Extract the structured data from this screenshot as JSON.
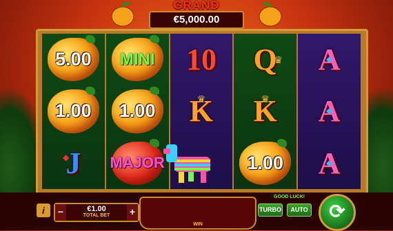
{
  "jackpot": {
    "label": "GRAND",
    "amount": "€5,000.00"
  },
  "reels": [
    {
      "cells": [
        {
          "type": "pepper",
          "text": "5.00"
        },
        {
          "type": "pepper",
          "text": "1.00"
        },
        {
          "type": "card",
          "text": "J",
          "variant": "j"
        }
      ]
    },
    {
      "cells": [
        {
          "type": "pepper",
          "text": "MINI",
          "variant": "mini"
        },
        {
          "type": "pepper",
          "text": "1.00"
        },
        {
          "type": "pepper",
          "text": "MAJOR",
          "variant": "major"
        }
      ]
    },
    {
      "cells": [
        {
          "type": "card",
          "text": "10",
          "variant": "ten"
        },
        {
          "type": "card",
          "text": "K",
          "variant": "k"
        },
        {
          "type": "pinata",
          "text": ""
        }
      ]
    },
    {
      "cells": [
        {
          "type": "card",
          "text": "Q",
          "variant": "q"
        },
        {
          "type": "card",
          "text": "K",
          "variant": "k"
        },
        {
          "type": "pepper",
          "text": "1.00"
        }
      ]
    },
    {
      "cells": [
        {
          "type": "card",
          "text": "A",
          "variant": "a"
        },
        {
          "type": "card",
          "text": "A",
          "variant": "a"
        },
        {
          "type": "card",
          "text": "A",
          "variant": "a"
        }
      ]
    }
  ],
  "bottom": {
    "info": "i",
    "minus": "−",
    "plus": "+",
    "bet_value": "€1.00",
    "bet_label": "TOTAL BET",
    "win_label": "WIN",
    "good_luck": "GOOD LUCK!",
    "turbo": "TURBO",
    "auto": "AUTO",
    "spin_icon": "⟳"
  },
  "colors": {
    "accent": "#d79a3b",
    "spin": "#1b7f1e"
  },
  "icons": {
    "crown": "crown-icon",
    "gem": "gem-icon",
    "spin": "refresh-icon"
  }
}
